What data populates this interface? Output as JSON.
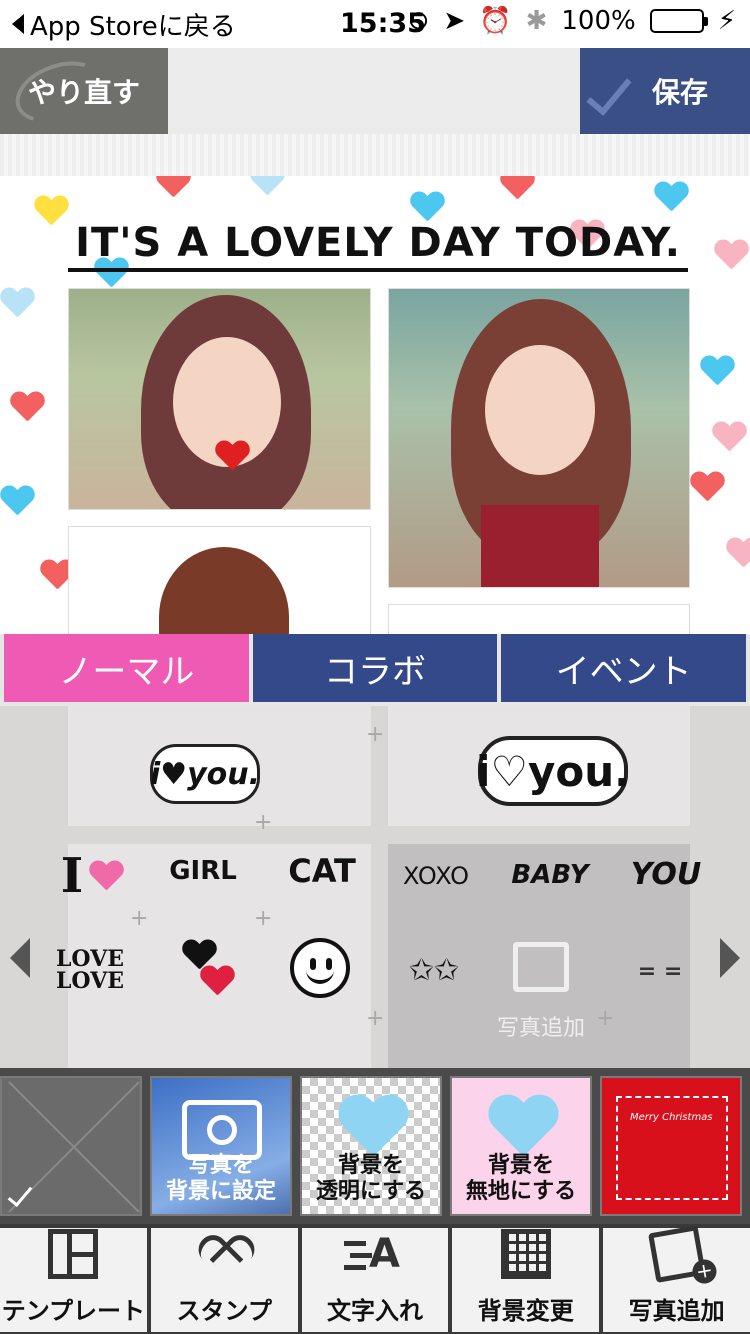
{
  "status_bar": {
    "back_label": "App Storeに戻る",
    "time": "15:35",
    "battery_percent": "100%",
    "battery_level": 1.0
  },
  "toolbar": {
    "redo_label": "やり直す",
    "save_label": "保存"
  },
  "template": {
    "title": "IT'S A LOVELY DAY TODAY."
  },
  "tabs": [
    {
      "label": "ノーマル",
      "active": true
    },
    {
      "label": "コラボ",
      "active": false
    },
    {
      "label": "イベント",
      "active": false
    }
  ],
  "stamps": {
    "iloveyou_small": "i♥you.",
    "iloveyou_big": "i♡you.",
    "i_girl": "GIRL",
    "i_cat": "CAT",
    "i_xoxo": "XOXO",
    "i_baby": "BABY",
    "i_you": "YOU",
    "love_love": "LOVE LOVE",
    "letter_i": "I",
    "add_photo_label": "写真追加"
  },
  "backgrounds": [
    {
      "id": "none",
      "label": ""
    },
    {
      "id": "photo",
      "label": "写真を\n背景に設定"
    },
    {
      "id": "transparent",
      "label": "背景を\n透明にする"
    },
    {
      "id": "plain",
      "label": "背景を\n無地にする"
    },
    {
      "id": "xmas",
      "label": "Merry Christmas"
    }
  ],
  "bottom_menu": [
    {
      "label": "テンプレート",
      "icon": "template-icon"
    },
    {
      "label": "スタンプ",
      "icon": "heart-icon"
    },
    {
      "label": "文字入れ",
      "icon": "text-icon"
    },
    {
      "label": "背景変更",
      "icon": "background-icon"
    },
    {
      "label": "写真追加",
      "icon": "add-photo-icon"
    }
  ],
  "colors": {
    "pink_tab": "#ee5ab4",
    "navy": "#34498a",
    "save_blue": "#3a4f86"
  }
}
